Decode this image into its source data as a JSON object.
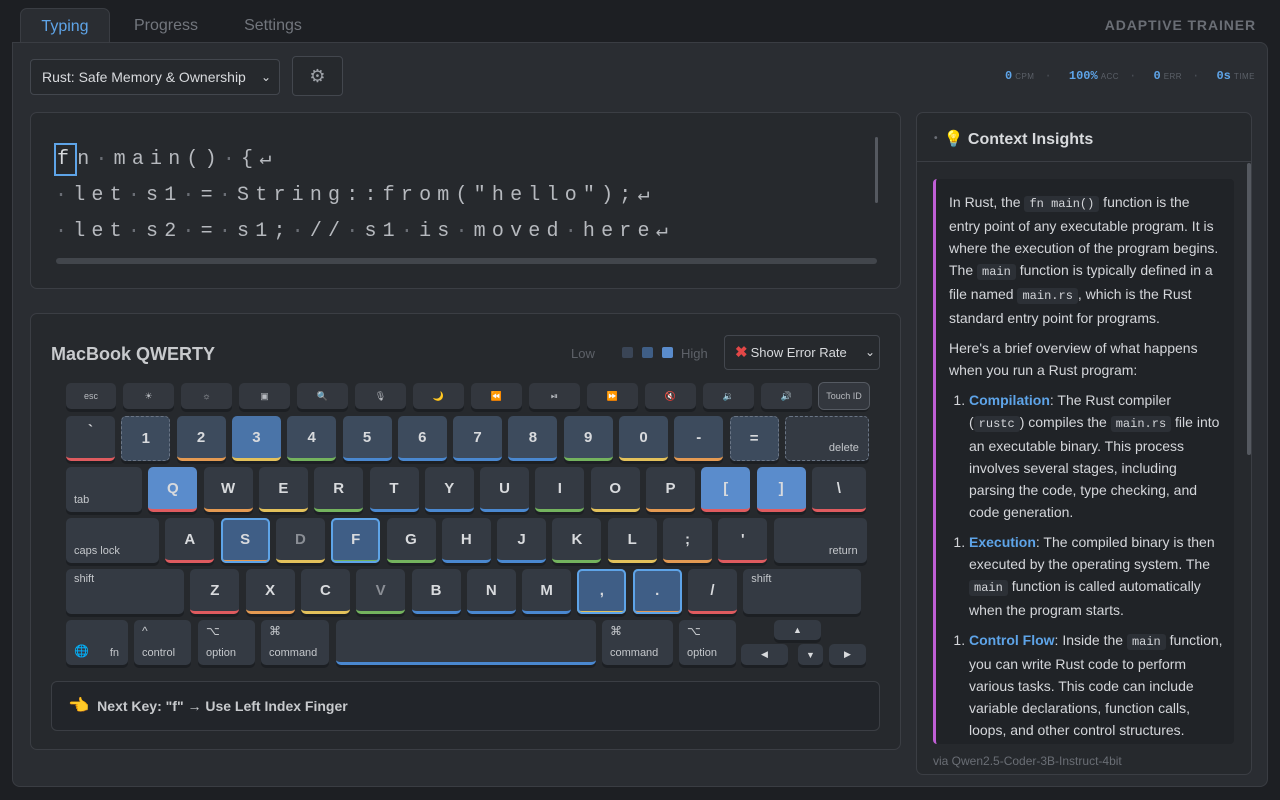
{
  "tabs": [
    "Typing",
    "Progress",
    "Settings"
  ],
  "brand": "ADAPTIVE TRAINER",
  "course": "Rust: Safe Memory & Ownership",
  "stats": [
    {
      "value": "0",
      "unit": "CPM"
    },
    {
      "value": "100%",
      "unit": "ACC"
    },
    {
      "value": "0",
      "unit": "ERR"
    },
    {
      "value": "0s",
      "unit": "TIME"
    }
  ],
  "text_lines": [
    "fn main() {↵",
    " let s1 = String::from(\"hello\");↵",
    " let s2 = s1; // s1 is moved here↵"
  ],
  "keyboard": {
    "title": "MacBook QWERTY",
    "legend_low": "Low",
    "legend_high": "High",
    "mode": "Show Error Rate",
    "fn_row": [
      "esc",
      "☀",
      "☼",
      "▣",
      "🔍",
      "🎙",
      "🌙",
      "⏪",
      "⏯",
      "⏩",
      "🔇",
      "🔉",
      "🔊",
      "Touch ID"
    ],
    "num_row": [
      "`",
      "1",
      "2",
      "3",
      "4",
      "5",
      "6",
      "7",
      "8",
      "9",
      "0",
      "-",
      "=",
      "delete"
    ],
    "q_row": [
      "tab",
      "Q",
      "W",
      "E",
      "R",
      "T",
      "Y",
      "U",
      "I",
      "O",
      "P",
      "[",
      "]",
      "\\"
    ],
    "a_row": [
      "caps lock",
      "A",
      "S",
      "D",
      "F",
      "G",
      "H",
      "J",
      "K",
      "L",
      ";",
      "'",
      "return"
    ],
    "z_row": [
      "shift",
      "Z",
      "X",
      "C",
      "V",
      "B",
      "N",
      "M",
      ",",
      ".",
      "/",
      "shift"
    ],
    "bottom": {
      "fn": "fn",
      "globe": "🌐",
      "control": "control",
      "control_sym": "^",
      "option": "option",
      "option_sym": "⌥",
      "command": "command",
      "command_sym": "⌘",
      "up": "▲",
      "left": "◀",
      "down": "▼",
      "right": "▶"
    }
  },
  "hint": {
    "icon": "👈",
    "text": "Next Key: \"f\" → Use Left Index Finger"
  },
  "insight": {
    "title": "Context Insights",
    "icon": "💡",
    "p1": [
      "In Rust, the ",
      "fn main()",
      " function is the entry point of any executable program. It is where the execution of the program begins. The ",
      "main",
      " function is typically defined in a file named ",
      "main.rs",
      ", which is the Rust standard entry point for programs."
    ],
    "p2": "Here's a brief overview of what happens when you run a Rust program:",
    "items": [
      {
        "n": "1.",
        "title": "Compilation",
        "parts": [
          ": The Rust compiler (",
          "rustc",
          ") compiles the ",
          "main.rs",
          " file into an executable binary. This process involves several stages, including parsing the code, type checking, and code generation."
        ]
      },
      {
        "n": "1.",
        "title": "Execution",
        "parts": [
          ": The compiled binary is then executed by the operating system. The ",
          "main",
          " function is called automatically when the program starts."
        ]
      },
      {
        "n": "1.",
        "title": "Control Flow",
        "parts": [
          ": Inside the ",
          "main",
          " function, you can write Rust code to perform various tasks. This code can include variable declarations, function calls, loops, and other control structures."
        ]
      }
    ],
    "footer": "via Qwen2.5-Coder-3B-Instruct-4bit"
  },
  "colors": {
    "accent": "#5ea4e8",
    "error": "#e24747",
    "insight_border": "#c05fd6"
  }
}
